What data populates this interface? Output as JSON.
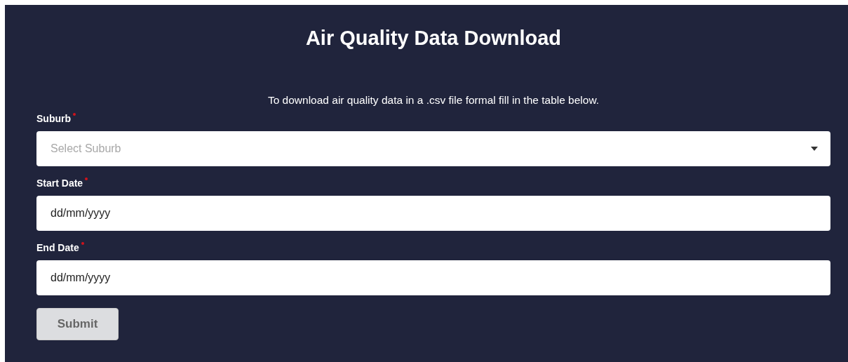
{
  "title": "Air Quality Data Download",
  "description": "To download air quality data in a .csv file formal fill in the table below.",
  "fields": [
    {
      "kind": "select",
      "label": "Suburb",
      "required": true,
      "placeholder": "Select Suburb"
    },
    {
      "kind": "date",
      "label": "Start Date",
      "required": true,
      "value": "dd/mm/yyyy"
    },
    {
      "kind": "date",
      "label": "End Date",
      "required": true,
      "value": "dd/mm/yyyy"
    }
  ],
  "submit": {
    "label": "Submit",
    "disabled": true
  }
}
